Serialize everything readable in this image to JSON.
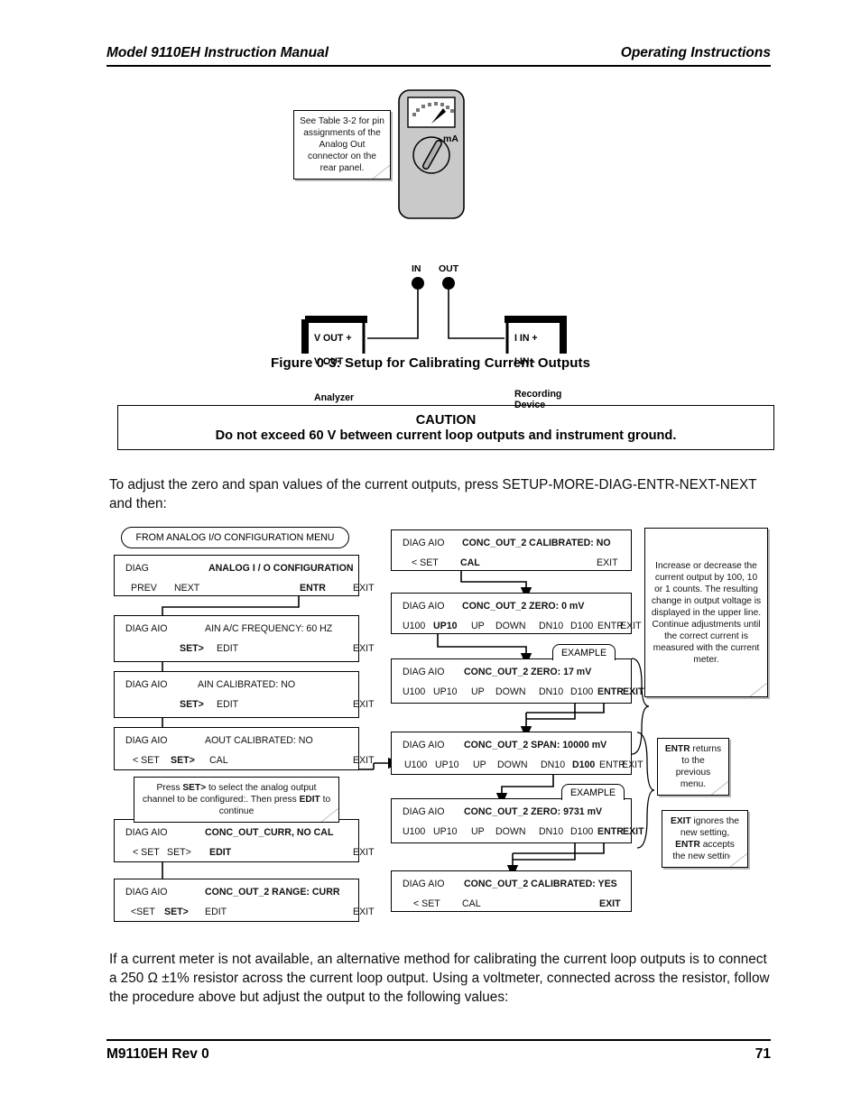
{
  "header": {
    "left": "Model 9110EH Instruction Manual",
    "right": "Operating Instructions"
  },
  "footer": {
    "left": "M9110EH Rev 0",
    "page": "71"
  },
  "figure": {
    "caption": "Figure 0-3:   Setup for Calibrating Current Outputs",
    "callout": "See Table 3-2 for pin assignments of the Analog Out connector on the rear panel.",
    "meter": {
      "unit_label": "mA",
      "jack_in": "IN",
      "jack_out": "OUT"
    },
    "analyzer": {
      "title": "Analyzer",
      "terminal_1": "V OUT +",
      "terminal_2": "V OUT -"
    },
    "recorder": {
      "title_line1": "Recording",
      "title_line2": "Device",
      "terminal_1": "I IN +",
      "terminal_2": "I IN -"
    }
  },
  "caution": {
    "title": "CAUTION",
    "text": "Do not exceed 60 V between current loop outputs and instrument ground."
  },
  "body": {
    "intro": "To adjust the zero and span values of the current outputs, press SETUP-MORE-DIAG-ENTR-NEXT-NEXT and then:",
    "outro": "If a current meter is not available, an alternative method for calibrating the current loop outputs is to connect a 250 Ω ±1% resistor across the current loop output. Using a voltmeter, connected across the resistor, follow the procedure above but adjust the output to the following values:"
  },
  "flowchart": {
    "start_oval": "FROM ANALOG I/O CONFIGURATION MENU",
    "example_tab": "EXAMPLE",
    "left_column": [
      {
        "prefix": "DIAG",
        "title": "ANALOG I / O CONFIGURATION",
        "title_bold": true,
        "softkeys": [
          "PREV",
          "NEXT",
          "ENTR",
          "EXIT"
        ],
        "bold_keys": [
          "ENTR"
        ]
      },
      {
        "prefix": "DIAG AIO",
        "title": "AIN A/C FREQUENCY: 60 HZ",
        "title_bold": false,
        "softkeys": [
          "SET>",
          "EDIT",
          "EXIT"
        ],
        "bold_keys": [
          "SET>"
        ]
      },
      {
        "prefix": "DIAG AIO",
        "title": "AIN CALIBRATED: NO",
        "title_bold": false,
        "softkeys": [
          "SET>",
          "EDIT",
          "EXIT"
        ],
        "bold_keys": [
          "SET>"
        ]
      },
      {
        "prefix": "DIAG AIO",
        "title": "AOUT CALIBRATED: NO",
        "title_bold": false,
        "softkeys": [
          "< SET",
          "SET>",
          "CAL",
          "EXIT"
        ],
        "bold_keys": [
          "SET>"
        ]
      },
      {
        "prefix": "DIAG AIO",
        "title": "CONC_OUT_CURR, NO CAL",
        "title_bold": true,
        "softkeys": [
          "< SET",
          "SET>",
          "EDIT",
          "EXIT"
        ],
        "bold_keys": [
          "EDIT"
        ]
      },
      {
        "prefix": "DIAG AIO",
        "title": "CONC_OUT_2 RANGE: CURR",
        "title_bold": true,
        "softkeys": [
          "<SET",
          "SET>",
          "EDIT",
          "EXIT"
        ],
        "bold_keys": [
          "SET>"
        ]
      }
    ],
    "left_callout": "Press SET> to select the analog output channel to be configured:. Then press EDIT to continue",
    "middle_column": [
      {
        "prefix": "DIAG AIO",
        "title": "CONC_OUT_2 CALIBRATED: NO",
        "title_bold": true,
        "softkeys": [
          "< SET",
          "CAL",
          "EXIT"
        ],
        "bold_keys": [
          "CAL"
        ]
      },
      {
        "prefix": "DIAG AIO",
        "title": "CONC_OUT_2 ZERO: 0 mV",
        "title_bold": true,
        "softkeys": [
          "U100",
          "UP10",
          "UP",
          "DOWN",
          "DN10",
          "D100",
          "ENTR",
          "EXIT"
        ],
        "bold_keys": [
          "UP10"
        ]
      },
      {
        "prefix": "DIAG AIO",
        "title": "CONC_OUT_2 ZERO: 17 mV",
        "title_bold": true,
        "softkeys": [
          "U100",
          "UP10",
          "UP",
          "DOWN",
          "DN10",
          "D100",
          "ENTR",
          "EXIT"
        ],
        "bold_keys": [
          "ENTR",
          "EXIT"
        ]
      },
      {
        "prefix": "DIAG AIO",
        "title": "CONC_OUT_2 SPAN: 10000 mV",
        "title_bold": true,
        "softkeys": [
          "U100",
          "UP10",
          "UP",
          "DOWN",
          "DN10",
          "D100",
          "ENTR",
          "EXIT"
        ],
        "bold_keys": [
          "D100"
        ]
      },
      {
        "prefix": "DIAG AIO",
        "title": "CONC_OUT_2 ZERO: 9731 mV",
        "title_bold": true,
        "softkeys": [
          "U100",
          "UP10",
          "UP",
          "DOWN",
          "DN10",
          "D100",
          "ENTR",
          "EXIT"
        ],
        "bold_keys": [
          "ENTR",
          "EXIT"
        ]
      },
      {
        "prefix": "DIAG AIO",
        "title": "CONC_OUT_2 CALIBRATED: YES",
        "title_bold": true,
        "softkeys": [
          "< SET",
          "CAL",
          "EXIT"
        ],
        "bold_keys": [
          "EXIT"
        ]
      }
    ],
    "right_notes": [
      "Increase or decrease the current output by 100, 10 or 1 counts. The resulting change in output voltage is displayed in the upper line. Continue adjustments until the correct current is measured with the current meter.",
      "ENTR returns to the previous menu.",
      "EXIT ignores the new  setting, ENTR accepts the new setting."
    ]
  }
}
